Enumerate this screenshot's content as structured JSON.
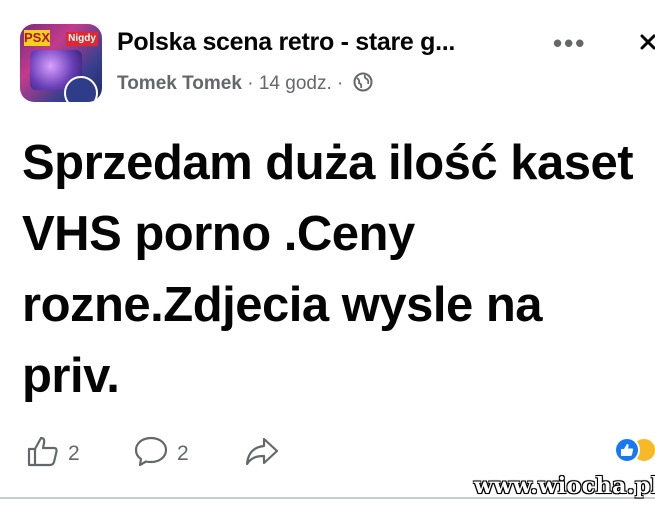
{
  "post": {
    "group_name": "Polska scena retro - stare g...",
    "author": "Tomek Tomek",
    "separator": "·",
    "time": "14 godz.",
    "separator2": "·",
    "text": "Sprzedam duża ilość kaset VHS porno .Ceny rozne.Zdjecia wysle na priv."
  },
  "avatar": {
    "tag1": "PSX",
    "tag2": "Nigdy"
  },
  "actions": {
    "like_count": "2",
    "comment_count": "2"
  },
  "icons": {
    "more": "more-options-icon",
    "close": "close-icon",
    "globe": "globe-icon",
    "like": "thumbs-up-icon",
    "comment": "comment-bubble-icon",
    "share": "share-arrow-icon",
    "reactions": "reaction-icons"
  },
  "watermark": "www.wiocha.pl",
  "colors": {
    "text": "#050505",
    "secondary": "#65676b",
    "like_blue": "#1877f2",
    "divider": "#c9ccd1"
  }
}
